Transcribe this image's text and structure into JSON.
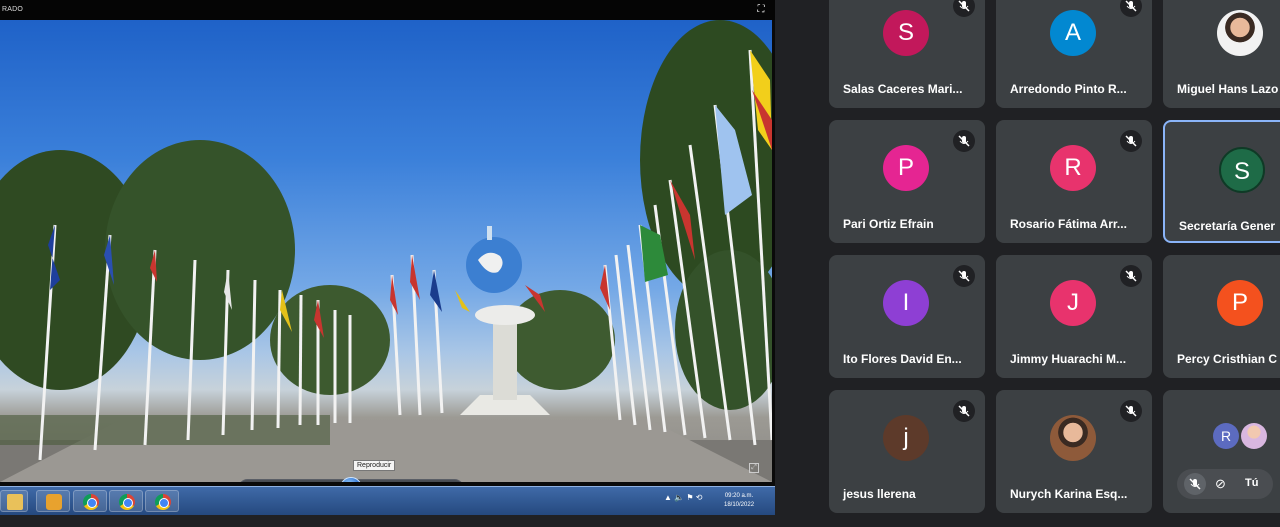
{
  "shared_screen": {
    "title_fragment": "RADO",
    "tooltip": "Reproducir",
    "clock": {
      "time": "09:20 a.m.",
      "date": "18/10/2022"
    }
  },
  "participants": [
    {
      "name": "Salas Caceres Mari...",
      "initial": "S",
      "color": "#c2185b",
      "muted": true
    },
    {
      "name": "Arredondo Pinto R...",
      "initial": "A",
      "color": "#0288d1",
      "muted": true
    },
    {
      "name": "Miguel Hans Lazo",
      "initial": "",
      "color": "#ddd",
      "muted": true,
      "photo": true
    },
    {
      "name": "Pari Ortiz Efrain",
      "initial": "P",
      "color": "#e52592",
      "muted": true
    },
    {
      "name": "Rosario Fátima Arr...",
      "initial": "R",
      "color": "#e8336d",
      "muted": true
    },
    {
      "name": "Secretaría Gener",
      "initial": "S",
      "color": "#1e6b47",
      "muted": false,
      "active": true
    },
    {
      "name": "Ito Flores David En...",
      "initial": "I",
      "color": "#8e3fd4",
      "muted": true
    },
    {
      "name": "Jimmy Huarachi M...",
      "initial": "J",
      "color": "#e8336d",
      "muted": true
    },
    {
      "name": "Percy Cristhian C",
      "initial": "P",
      "color": "#f4511e",
      "muted": false
    },
    {
      "name": "jesus llerena",
      "initial": "j",
      "color": "#5d3a2a",
      "muted": true
    },
    {
      "name": "Nurych Karina Esq...",
      "initial": "",
      "color": "#aaa",
      "muted": true,
      "photo": true
    }
  ],
  "self_tile": {
    "label": "Tú",
    "initial": "R",
    "color": "#5c6bc0"
  }
}
